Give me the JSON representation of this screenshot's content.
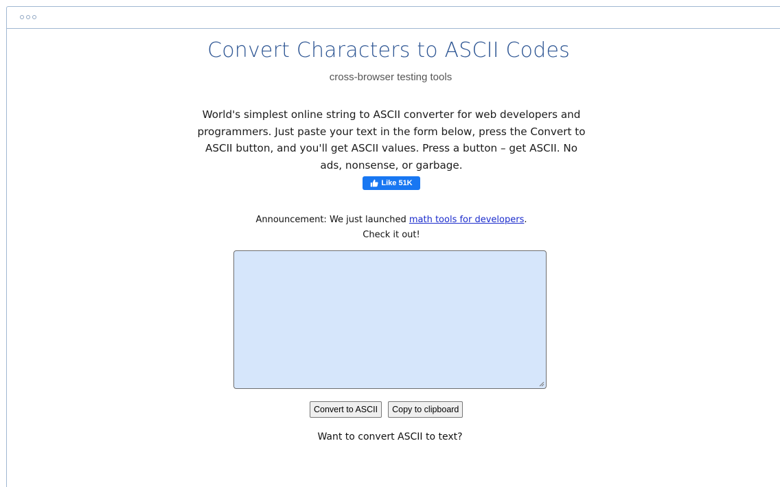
{
  "page": {
    "title": "Convert Characters to ASCII Codes",
    "subtitle": "cross-browser testing tools",
    "intro": "World's simplest online string to ASCII converter for web developers and programmers. Just paste your text in the form below, press the Convert to ASCII button, and you'll get ASCII values. Press a button – get ASCII. No ads, nonsense, or garbage."
  },
  "like_button": {
    "label": "Like 51K",
    "icon": "thumbs-up-icon",
    "color": "#1877f2"
  },
  "announcement": {
    "label": "Announcement:",
    "text_before": " We just launched ",
    "link_text": "math tools for developers",
    "text_after": ".",
    "line2": "Check it out!"
  },
  "input": {
    "value": "",
    "background": "#d6e6fb"
  },
  "buttons": {
    "convert": "Convert to ASCII",
    "copy": "Copy to clipboard"
  },
  "footer_prompt": "Want to convert ASCII to text?",
  "colors": {
    "title": "#2d5593",
    "link": "#1a2bcc",
    "window_border": "#9fb7d2"
  }
}
